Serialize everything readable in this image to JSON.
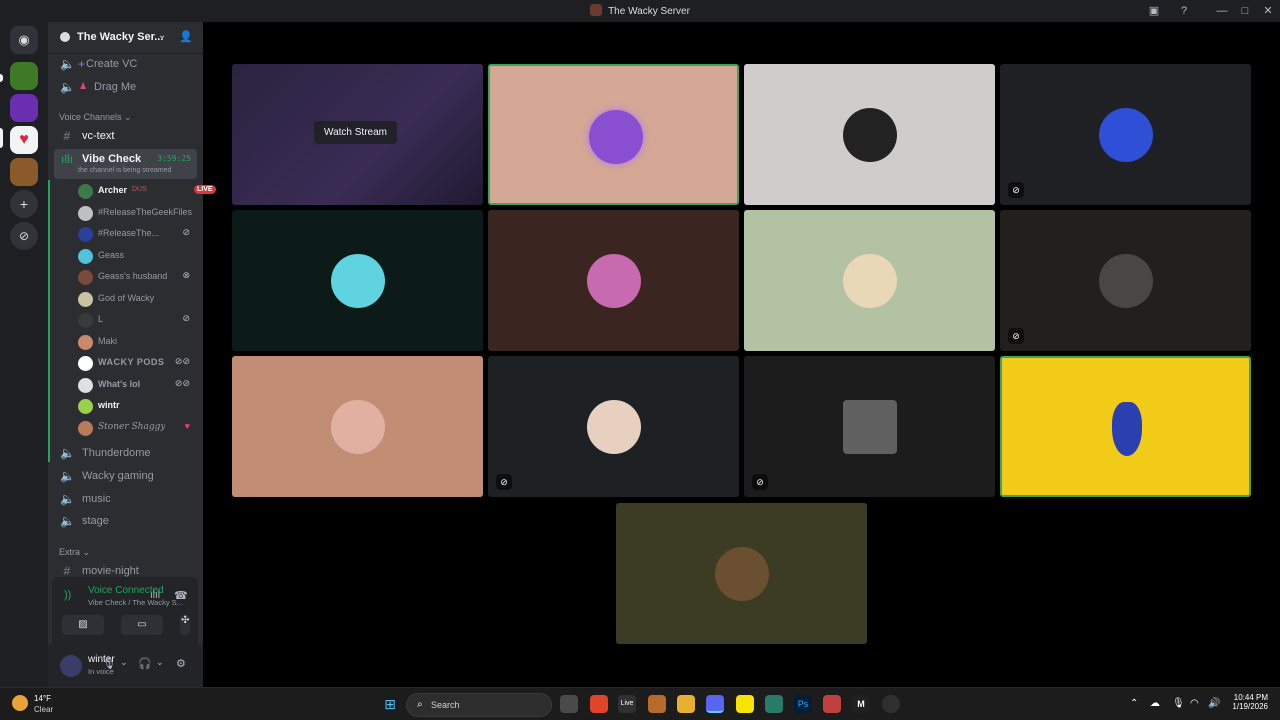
{
  "window": {
    "title": "The Wacky Server"
  },
  "server": {
    "name": "The Wacky Ser..."
  },
  "channels_top": [
    {
      "label": "Create VC",
      "icon": "speaker-icon"
    },
    {
      "label": "Drag Me",
      "icon": "speaker-icon"
    }
  ],
  "categories": {
    "voice": "Voice Channels",
    "extra": "Extra"
  },
  "vc_text": "vc-text",
  "active_vc": {
    "label": "Vibe Check",
    "timer": "3:59:25",
    "subtitle": "the channel is being streamed"
  },
  "members": [
    {
      "name": "Archer",
      "extra": "DUS",
      "live": "LIVE",
      "color": "#3d7a4a"
    },
    {
      "name": "#ReleaseTheGeekFiles",
      "color": "#c0c0c0"
    },
    {
      "name": "#ReleaseThe...",
      "color": "#2a3e9e"
    },
    {
      "name": "Geass",
      "color": "#4fc3d9"
    },
    {
      "name": "Geass's husband",
      "color": "#7a4a3a"
    },
    {
      "name": "God of Wacky",
      "color": "#c9c2a0"
    },
    {
      "name": "L",
      "color": "#3a3a3a"
    },
    {
      "name": "Maki",
      "color": "#c9896a"
    },
    {
      "name": "WACKY PODS",
      "color": "#ffffff"
    },
    {
      "name": "What's lol",
      "color": "#e0e0e0"
    },
    {
      "name": "wintr",
      "color": "#9ad14a"
    },
    {
      "name": "Stoner Shaggy",
      "color": "#b87a5a"
    }
  ],
  "channels_bottom": [
    "Thunderdome",
    "Wacky gaming",
    "music",
    "stage"
  ],
  "extra_channels": [
    "movie-night"
  ],
  "voice_panel": {
    "title": "Voice Connected",
    "subtitle": "Vibe Check / The Wacky S..."
  },
  "user": {
    "name": "winter",
    "status": "In voice"
  },
  "tiles": [
    {
      "bg": "#2a2340",
      "avatar": "",
      "label": "Watch Stream",
      "stream": true
    },
    {
      "bg": "#d4a894",
      "avatar": "#8a4fd0",
      "speaking": true
    },
    {
      "bg": "#d0cccc",
      "avatar": "#222222"
    },
    {
      "bg": "#1f2023",
      "avatar": "#2f4fd6",
      "status": "deafened-icon"
    },
    {
      "bg": "#0c1a18",
      "avatar": "#5fd3e0"
    },
    {
      "bg": "#3a2520",
      "avatar": "#c86ab0"
    },
    {
      "bg": "#b3c2a2",
      "avatar": "#e8d8b8"
    },
    {
      "bg": "#231f1c",
      "avatar": "#4a4646",
      "status": "muted-icon"
    },
    {
      "bg": "#c18e75",
      "avatar": "#e0b0a0"
    },
    {
      "bg": "#1e2124",
      "avatar": "#e8d0c0",
      "status": "camera-off-icon"
    },
    {
      "bg": "#1c1c1c",
      "avatar": "#606060",
      "status": "camera-off-icon"
    },
    {
      "bg": "#f1cb18",
      "avatar": "#2a3fb0",
      "speaking": true
    },
    {
      "bg": "#3c3b24",
      "avatar": "#6a5030"
    }
  ],
  "taskbar": {
    "weather_temp": "14°F",
    "weather_cond": "Clear",
    "search_placeholder": "Search",
    "time": "10:44 PM",
    "date": "1/19/2026"
  }
}
